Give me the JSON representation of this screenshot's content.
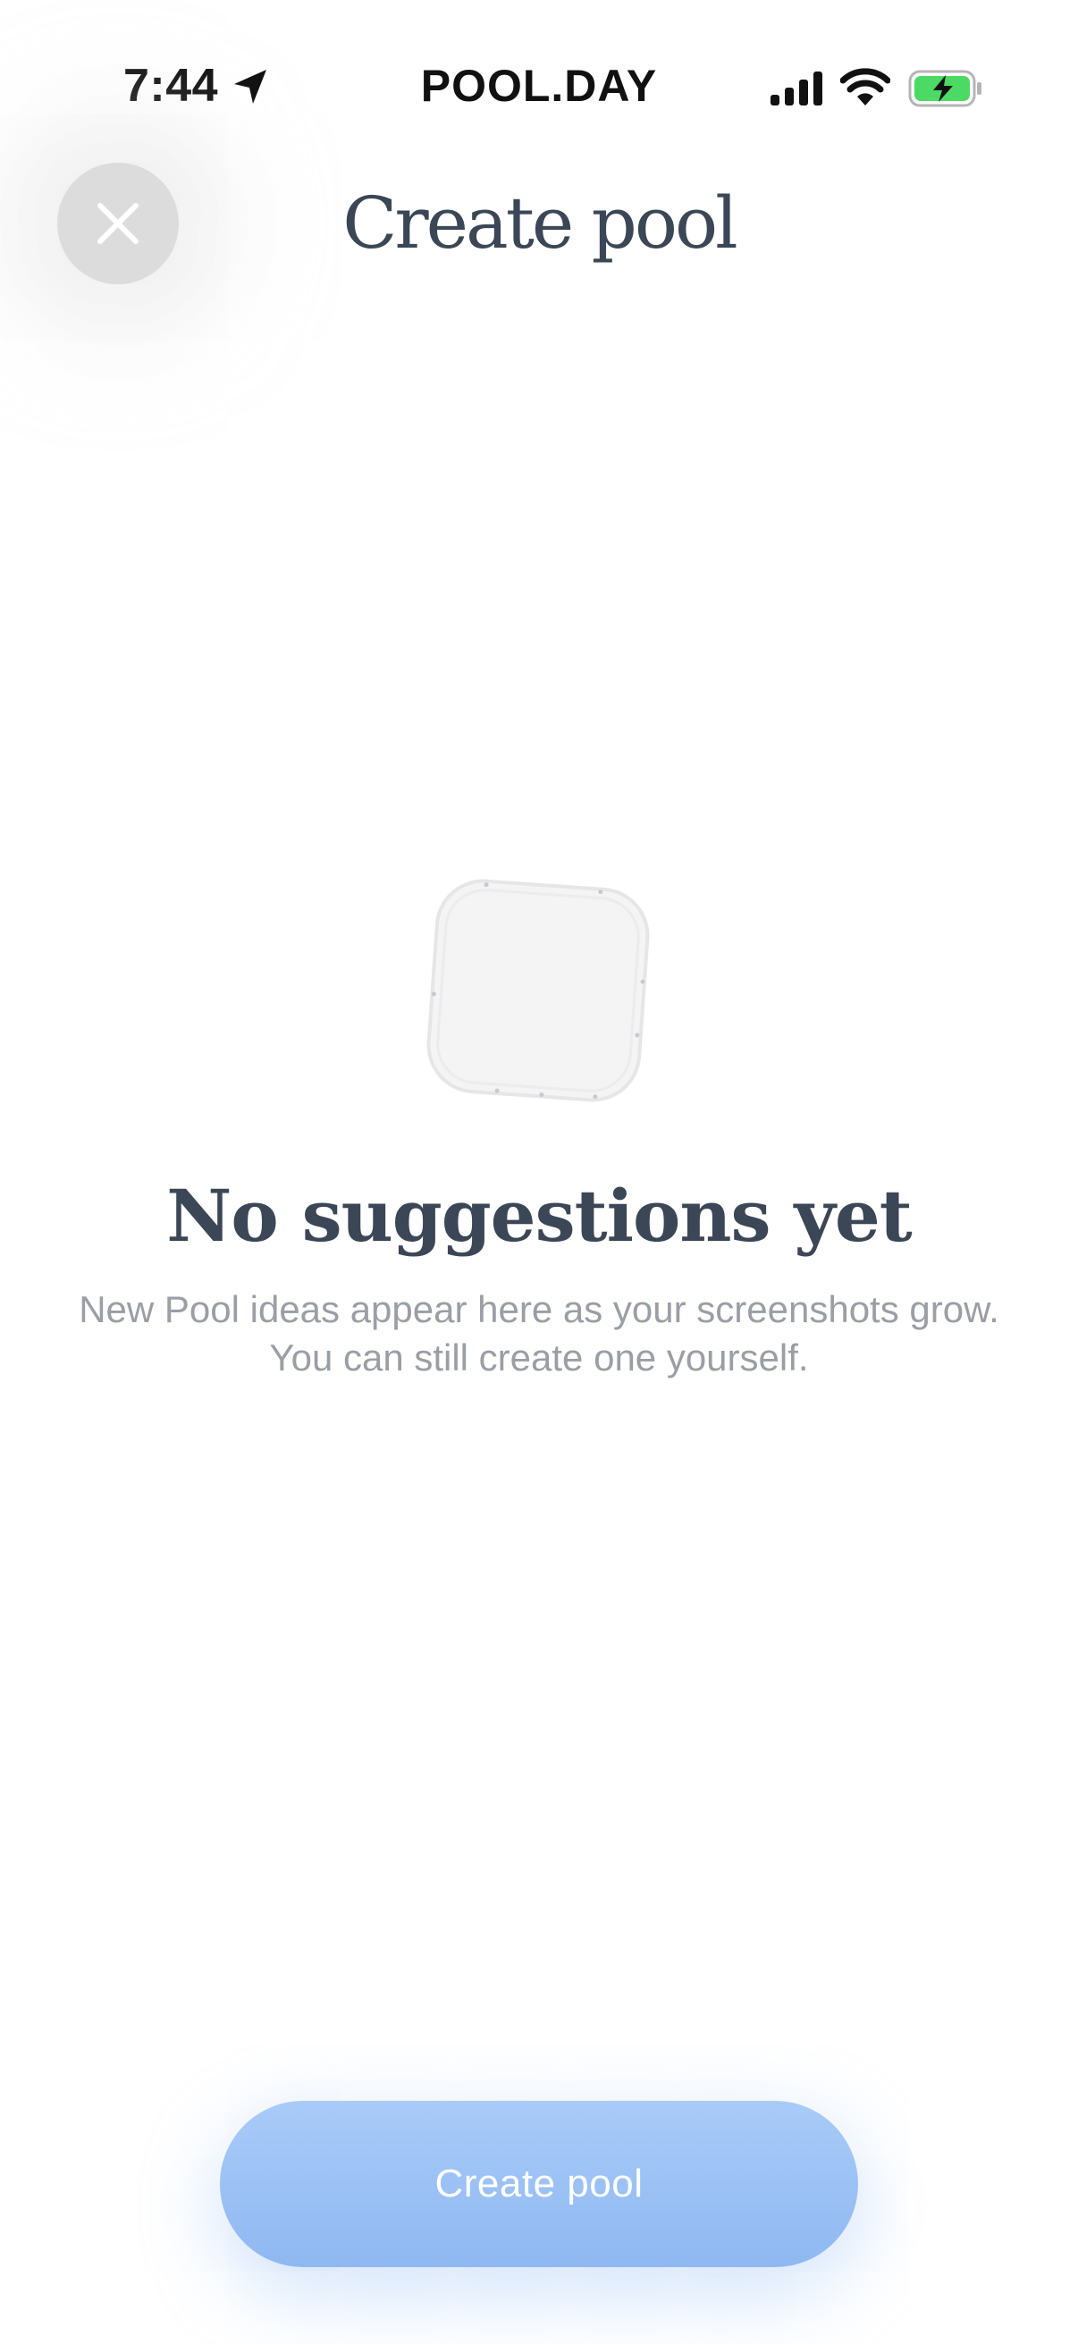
{
  "status_bar": {
    "time": "7:44",
    "carrier": "POOL.DAY",
    "icons": [
      "location-arrow-icon",
      "cellular-signal-icon",
      "wifi-icon",
      "battery-charging-icon"
    ],
    "battery_color": "#4cd964"
  },
  "header": {
    "close_icon": "close-icon",
    "title": "Create pool"
  },
  "empty_state": {
    "icon": "empty-placeholder-icon",
    "heading": "No suggestions yet",
    "description": "New Pool ideas appear here as your screenshots grow. You can still create one yourself."
  },
  "footer": {
    "create_label": "Create pool",
    "accent_color": "#8fb8f2"
  }
}
